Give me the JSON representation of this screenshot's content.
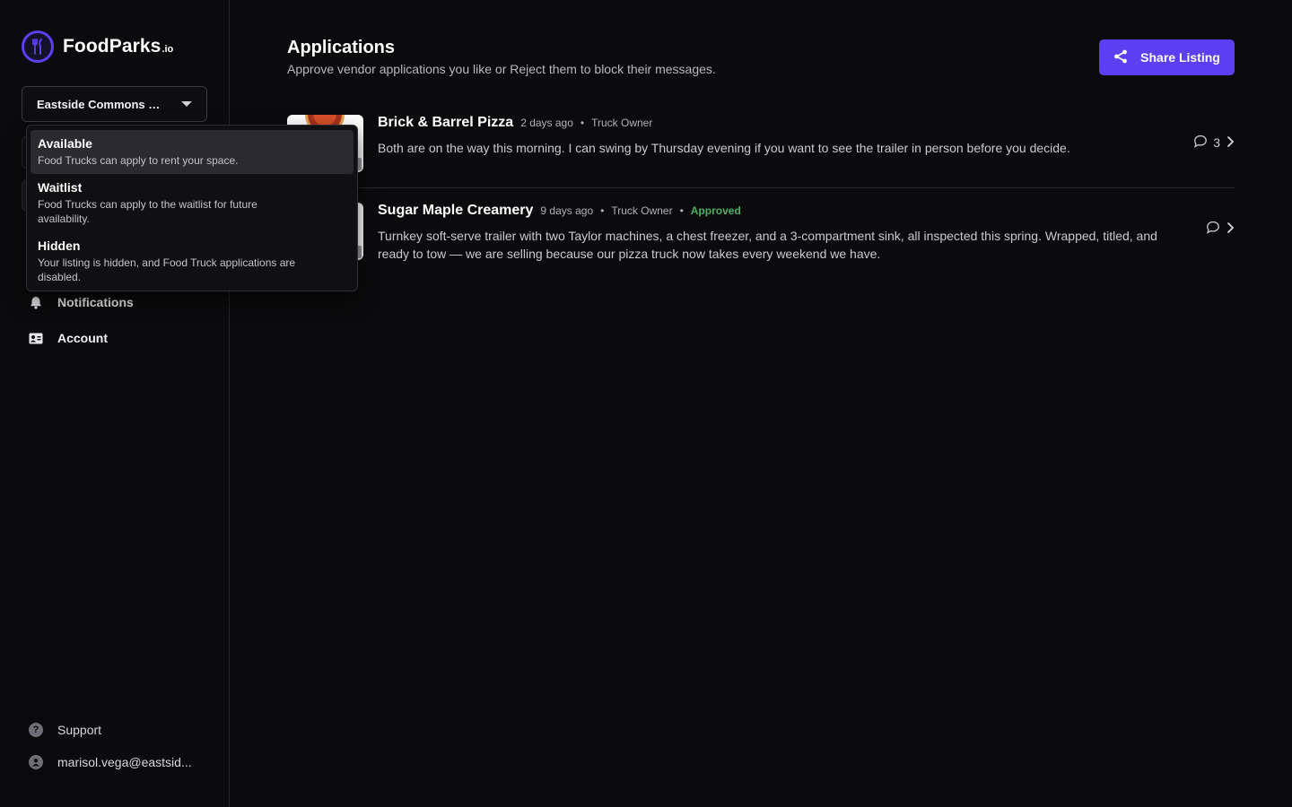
{
  "brand": {
    "name": "FoodParks",
    "suffix": ".io"
  },
  "park_selector": {
    "value": "Eastside Commons Fo..."
  },
  "listing_status_dropdown": {
    "options": [
      {
        "title": "Available",
        "description": "Food Trucks can apply to rent your space.",
        "selected": true
      },
      {
        "title": "Waitlist",
        "description": "Food Trucks can apply to the waitlist for future availability.",
        "selected": false
      },
      {
        "title": "Hidden",
        "description": "Your listing is hidden, and Food Truck applications are disabled.",
        "selected": false
      }
    ]
  },
  "sidebar": {
    "items": [
      {
        "label": "Notifications",
        "icon": "bell-icon"
      },
      {
        "label": "Account",
        "icon": "id-card-icon"
      }
    ],
    "support_label": "Support",
    "user_email": "marisol.vega@eastsid..."
  },
  "page": {
    "title": "Applications",
    "subtitle": "Approve vendor applications you like or Reject them to block their messages.",
    "share_button": "Share Listing"
  },
  "applications": [
    {
      "name": "Brick & Barrel Pizza",
      "time": "2 days ago",
      "role": "Truck Owner",
      "status": "",
      "message": "Both are on the way this morning. I can swing by Thursday evening if you want to see the trailer in person before you decide.",
      "comment_count": "3"
    },
    {
      "name": "Sugar Maple Creamery",
      "time": "9 days ago",
      "role": "Truck Owner",
      "status": "Approved",
      "message": "Turnkey soft-serve trailer with two Taylor machines, a chest freezer, and a 3-compartment sink, all inspected this spring. Wrapped, titled, and ready to tow — we are selling because our pizza truck now takes every weekend we have.",
      "comment_count": ""
    }
  ],
  "colors": {
    "accent": "#5b3ff0",
    "approved": "#4caf62",
    "background": "#0b0b0d"
  }
}
